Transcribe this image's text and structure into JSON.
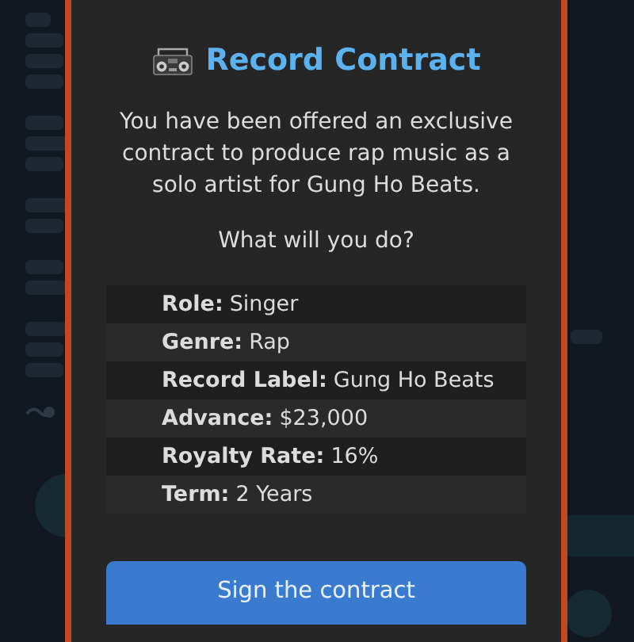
{
  "dialog": {
    "title": "Record Contract",
    "message": "You have been offered an exclusive contract to produce rap music as a solo artist for Gung Ho Beats.",
    "question": "What will you do?",
    "details": [
      {
        "label": "Role:",
        "value": "Singer"
      },
      {
        "label": "Genre:",
        "value": "Rap"
      },
      {
        "label": "Record Label:",
        "value": "Gung Ho Beats"
      },
      {
        "label": "Advance:",
        "value": "$23,000"
      },
      {
        "label": "Royalty Rate:",
        "value": "16%"
      },
      {
        "label": "Term:",
        "value": "2 Years"
      }
    ],
    "button": "Sign the contract"
  }
}
